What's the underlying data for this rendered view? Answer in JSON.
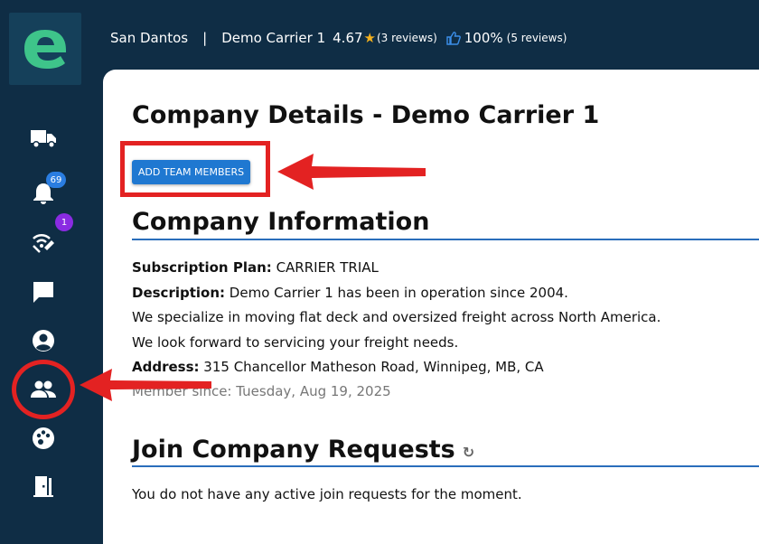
{
  "logo": {
    "letter_icon": "e-logo",
    "color": "#3ec48a"
  },
  "sidebar": {
    "items": [
      {
        "name": "truck-icon",
        "badge": null
      },
      {
        "name": "bell-icon",
        "badge": "69"
      },
      {
        "name": "signal-icon",
        "badge": "1"
      },
      {
        "name": "chat-icon",
        "badge": null
      },
      {
        "name": "account-icon",
        "badge": null
      },
      {
        "name": "team-icon",
        "badge": null
      },
      {
        "name": "palette-icon",
        "badge": null
      },
      {
        "name": "exit-door-icon",
        "badge": null
      }
    ]
  },
  "topbar": {
    "location": "San Dantos",
    "separator": "|",
    "company": "Demo Carrier 1",
    "rating": "4.67",
    "reviews": "(3 reviews)",
    "approval": "100%",
    "approval_reviews": "(5 reviews)"
  },
  "page": {
    "title": "Company Details - Demo Carrier 1",
    "add_button": "ADD TEAM MEMBERS",
    "company_info": {
      "heading": "Company Information",
      "plan_label": "Subscription Plan:",
      "plan_value": "CARRIER TRIAL",
      "desc_label": "Description:",
      "desc_line1": "Demo Carrier 1 has been in operation since 2004.",
      "desc_line2": "We specialize in moving flat deck and oversized freight across North America.",
      "desc_line3": "We look forward to servicing your freight needs.",
      "address_label": "Address:",
      "address_value": "315 Chancellor Matheson Road, Winnipeg, MB, CA",
      "member_since": "Member since: Tuesday, Aug 19, 2025"
    },
    "join_requests": {
      "heading": "Join Company Requests",
      "empty_text": "You do not have any active join requests for the moment."
    }
  },
  "colors": {
    "sidebar_bg": "#0f2d45",
    "accent_blue": "#1f78d1",
    "highlight_red": "#e32222"
  }
}
